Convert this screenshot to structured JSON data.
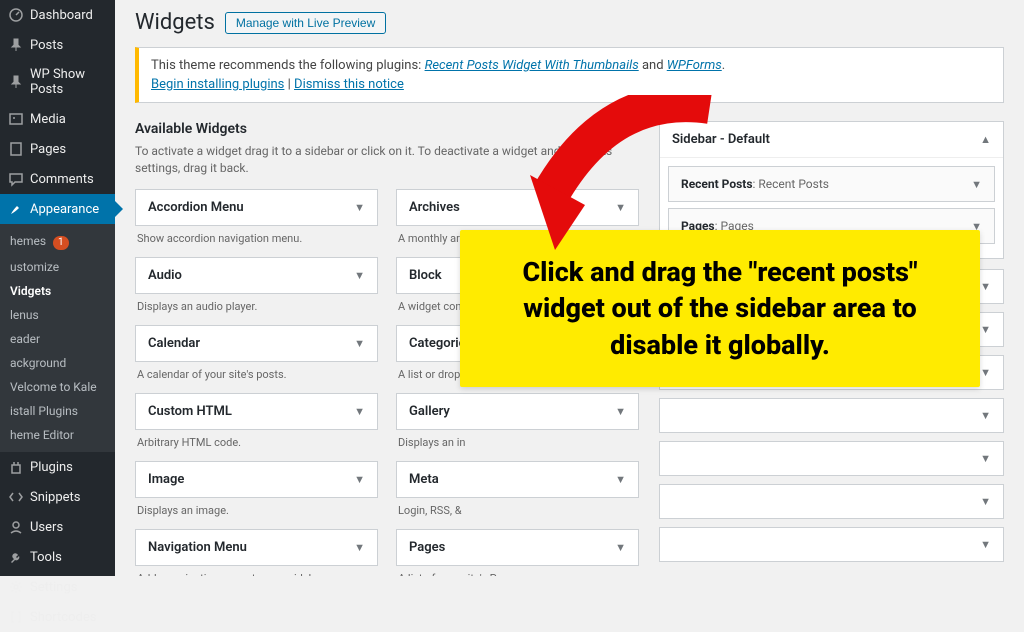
{
  "sidebar": {
    "items": [
      {
        "label": "Dashboard",
        "icon": "dashboard"
      },
      {
        "label": "Posts",
        "icon": "pin"
      },
      {
        "label": "WP Show Posts",
        "icon": "pin"
      },
      {
        "label": "Media",
        "icon": "media"
      },
      {
        "label": "Pages",
        "icon": "page"
      },
      {
        "label": "Comments",
        "icon": "comment"
      },
      {
        "label": "Appearance",
        "icon": "brush",
        "active": true
      },
      {
        "label": "Plugins",
        "icon": "plugin"
      },
      {
        "label": "Snippets",
        "icon": "code"
      },
      {
        "label": "Users",
        "icon": "users"
      },
      {
        "label": "Tools",
        "icon": "tools"
      },
      {
        "label": "Settings",
        "icon": "settings"
      },
      {
        "label": "Shortcodes",
        "icon": "bracket"
      }
    ],
    "appearance_sub": [
      {
        "label": "hemes",
        "badge": "1"
      },
      {
        "label": "ustomize"
      },
      {
        "label": "Vidgets",
        "active": true
      },
      {
        "label": "lenus"
      },
      {
        "label": "eader"
      },
      {
        "label": "ackground"
      },
      {
        "label": "Velcome to Kale"
      },
      {
        "label": "istall Plugins"
      },
      {
        "label": "heme Editor"
      }
    ]
  },
  "header": {
    "title": "Widgets",
    "live_preview_btn": "Manage with Live Preview"
  },
  "notice": {
    "text_before": "This theme recommends the following plugins: ",
    "plugin1": "Recent Posts Widget With Thumbnails",
    "and": " and ",
    "plugin2": "WPForms",
    "period": ".",
    "begin": "Begin installing plugins",
    "sep": " | ",
    "dismiss": "Dismiss this notice"
  },
  "available": {
    "heading": "Available Widgets",
    "desc": "To activate a widget drag it to a sidebar or click on it. To deactivate a widget and delete its settings, drag it back.",
    "col1": [
      {
        "name": "Accordion Menu",
        "desc": "Show accordion navigation menu."
      },
      {
        "name": "Audio",
        "desc": "Displays an audio player."
      },
      {
        "name": "Calendar",
        "desc": "A calendar of your site's posts."
      },
      {
        "name": "Custom HTML",
        "desc": "Arbitrary HTML code."
      },
      {
        "name": "Image",
        "desc": "Displays an image."
      },
      {
        "name": "Navigation Menu",
        "desc": "Add a navigation menu to your sidebar."
      }
    ],
    "col2": [
      {
        "name": "Archives",
        "desc": "A monthly arch"
      },
      {
        "name": "Block",
        "desc": "A widget cont"
      },
      {
        "name": "Categories",
        "desc": "A list or drop"
      },
      {
        "name": "Gallery",
        "desc": "Displays an in"
      },
      {
        "name": "Meta",
        "desc": "Login, RSS, &"
      },
      {
        "name": "Pages",
        "desc": "A list of your site's Pages."
      }
    ]
  },
  "sidebar_area": {
    "title": "Sidebar - Default",
    "widgets": [
      {
        "name": "Recent Posts",
        "sub": ": Recent Posts"
      },
      {
        "name": "Pages",
        "sub": ": Pages"
      }
    ]
  },
  "callout": {
    "text": "Click and drag the \"recent posts\" widget out of the sidebar area to disable it globally."
  }
}
